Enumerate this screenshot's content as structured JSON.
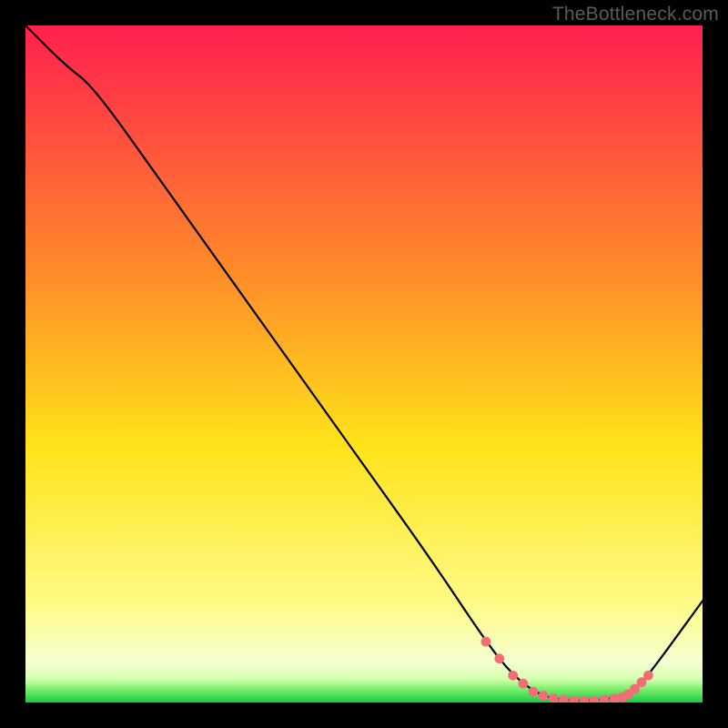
{
  "watermark": "TheBottleneck.com",
  "colors": {
    "bg": "#000000",
    "grad_top": "#ff1f4f",
    "grad_mid1": "#ff6f3a",
    "grad_mid2": "#ffd21a",
    "grad_low": "#fffb8a",
    "grad_white": "#faffde",
    "grad_green": "#1ee646",
    "line": "#000000",
    "dot": "#f26d76"
  },
  "chart_data": {
    "type": "line",
    "title": "",
    "xlabel": "",
    "ylabel": "",
    "xlim": [
      0,
      100
    ],
    "ylim": [
      0,
      100
    ],
    "series": [
      {
        "name": "curve",
        "x": [
          0,
          6,
          10,
          20,
          30,
          40,
          50,
          60,
          68,
          72,
          76,
          80,
          84,
          88,
          90,
          92,
          100
        ],
        "y": [
          100,
          94,
          91,
          77,
          63,
          49,
          35,
          21,
          9,
          4,
          1,
          0.3,
          0.3,
          0.8,
          2,
          4,
          15
        ]
      }
    ],
    "dots": {
      "name": "highlight",
      "x": [
        68,
        70,
        72,
        73.5,
        75,
        76.5,
        78,
        79.5,
        81,
        82.5,
        84,
        85.5,
        87,
        88.2,
        89,
        90,
        91,
        92
      ],
      "y": [
        9,
        6.5,
        4,
        2.8,
        1.6,
        1.0,
        0.6,
        0.4,
        0.3,
        0.3,
        0.3,
        0.4,
        0.6,
        0.8,
        1.2,
        2,
        3,
        4
      ]
    }
  }
}
